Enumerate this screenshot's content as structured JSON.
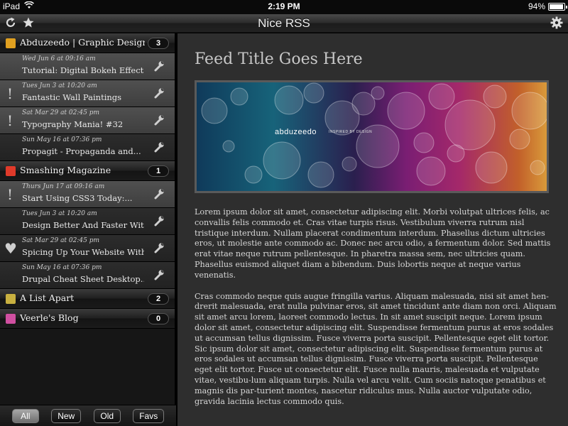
{
  "status": {
    "device": "iPad",
    "time": "2:19 PM",
    "battery": "94%",
    "battery_level": 0.94
  },
  "nav": {
    "title": "Nice RSS"
  },
  "sidebar": {
    "feeds": [
      {
        "name": "Abduzeedo | Graphic Design...",
        "count": "3",
        "icon_color": "#e0a020",
        "articles": [
          {
            "date": "Wed Jun 6 at 09:16 am",
            "title": "Tutorial: Digital Bokeh Effect",
            "mark": "",
            "state": "unread"
          },
          {
            "date": "Tues Jun 3 at 10:20 am",
            "title": "Fantastic Wall Paintings",
            "mark": "!",
            "state": "unread"
          },
          {
            "date": "Sat Mar 29 at 02:45 pm",
            "title": "Typography Mania! #32",
            "mark": "!",
            "state": "unread"
          },
          {
            "date": "Sun May 16 at 07:36 pm",
            "title": "Propagit - Propaganda and...",
            "mark": "",
            "state": "read"
          }
        ]
      },
      {
        "name": "Smashing Magazine",
        "count": "1",
        "icon_color": "#e03a2a",
        "articles": [
          {
            "date": "Thurs Jun 17 at 09:16 am",
            "title": "Start Using CSS3 Today:...",
            "mark": "!",
            "state": "unread"
          },
          {
            "date": "Tues Jun 3 at 10:20 am",
            "title": "Design Better And Faster With...",
            "mark": "",
            "state": "read"
          },
          {
            "date": "Sat Mar 29 at 02:45 pm",
            "title": "Spicing Up Your Website With...",
            "mark": "♥",
            "state": "read"
          },
          {
            "date": "Sun May 16 at 07:36 pm",
            "title": "Drupal Cheat Sheet Desktop...",
            "mark": "",
            "state": "read"
          }
        ]
      },
      {
        "name": "A List Apart",
        "count": "2",
        "icon_color": "#c8b040",
        "articles": []
      },
      {
        "name": "Veerle's Blog",
        "count": "0",
        "icon_color": "#d04fa0",
        "articles": []
      }
    ],
    "tabs": [
      {
        "label": "All",
        "active": true
      },
      {
        "label": "New",
        "active": false
      },
      {
        "label": "Old",
        "active": false
      },
      {
        "label": "Favs",
        "active": false
      }
    ]
  },
  "content": {
    "feed_title": "Feed Title Goes Here",
    "banner_logo": "abduzeedo",
    "banner_tag": "INSPIRED BY DESIGN",
    "paragraphs": [
      "Lorem ipsum dolor sit amet, consectetur adipiscing elit. Morbi volutpat ultrices felis, ac convallis felis commodo et. Cras vitae turpis risus. Vestibulum viverra rutrum nisl tristique interdum. Nullam placerat condimentum interdum. Phasellus dictum ultricies eros, ut molestie ante commodo ac. Donec nec arcu odio, a fermentum dolor. Sed mattis erat vitae neque rutrum pellentesque. In pharetra massa sem, nec ultricies quam. Phasellus euismod aliquet diam a bibendum. Duis lobortis neque at neque varius venenatis.",
      "Cras commodo neque quis augue fringilla varius. Aliquam malesuada, nisi sit amet hen-drerit malesuada, erat nulla pulvinar eros, sit amet tincidunt ante diam non orci. Aliquam sit amet arcu lorem, laoreet commodo lectus. In sit amet suscipit neque. Lorem ipsum dolor sit amet, consectetur adipiscing elit. Suspendisse fermentum purus at eros sodales ut accumsan tellus dignissim. Fusce viverra porta suscipit. Pellentesque eget elit tortor. Sic ipsum dolor sit amet, consectetur adipiscing elit. Suspendisse fermentum purus at eros sodales ut accumsan tellus dignissim. Fusce viverra porta suscipit. Pellentesque eget elit tortor. Fusce ut consectetur elit. Fusce nulla mauris, malesuada et vulputate vitae, vestibu-lum aliquam turpis. Nulla vel arcu velit. Cum sociis natoque penatibus et magnis dis par-turient montes, nascetur ridiculus mus. Nulla auctor vulputate odio, gravida lacinia lectus commodo quis."
    ]
  }
}
